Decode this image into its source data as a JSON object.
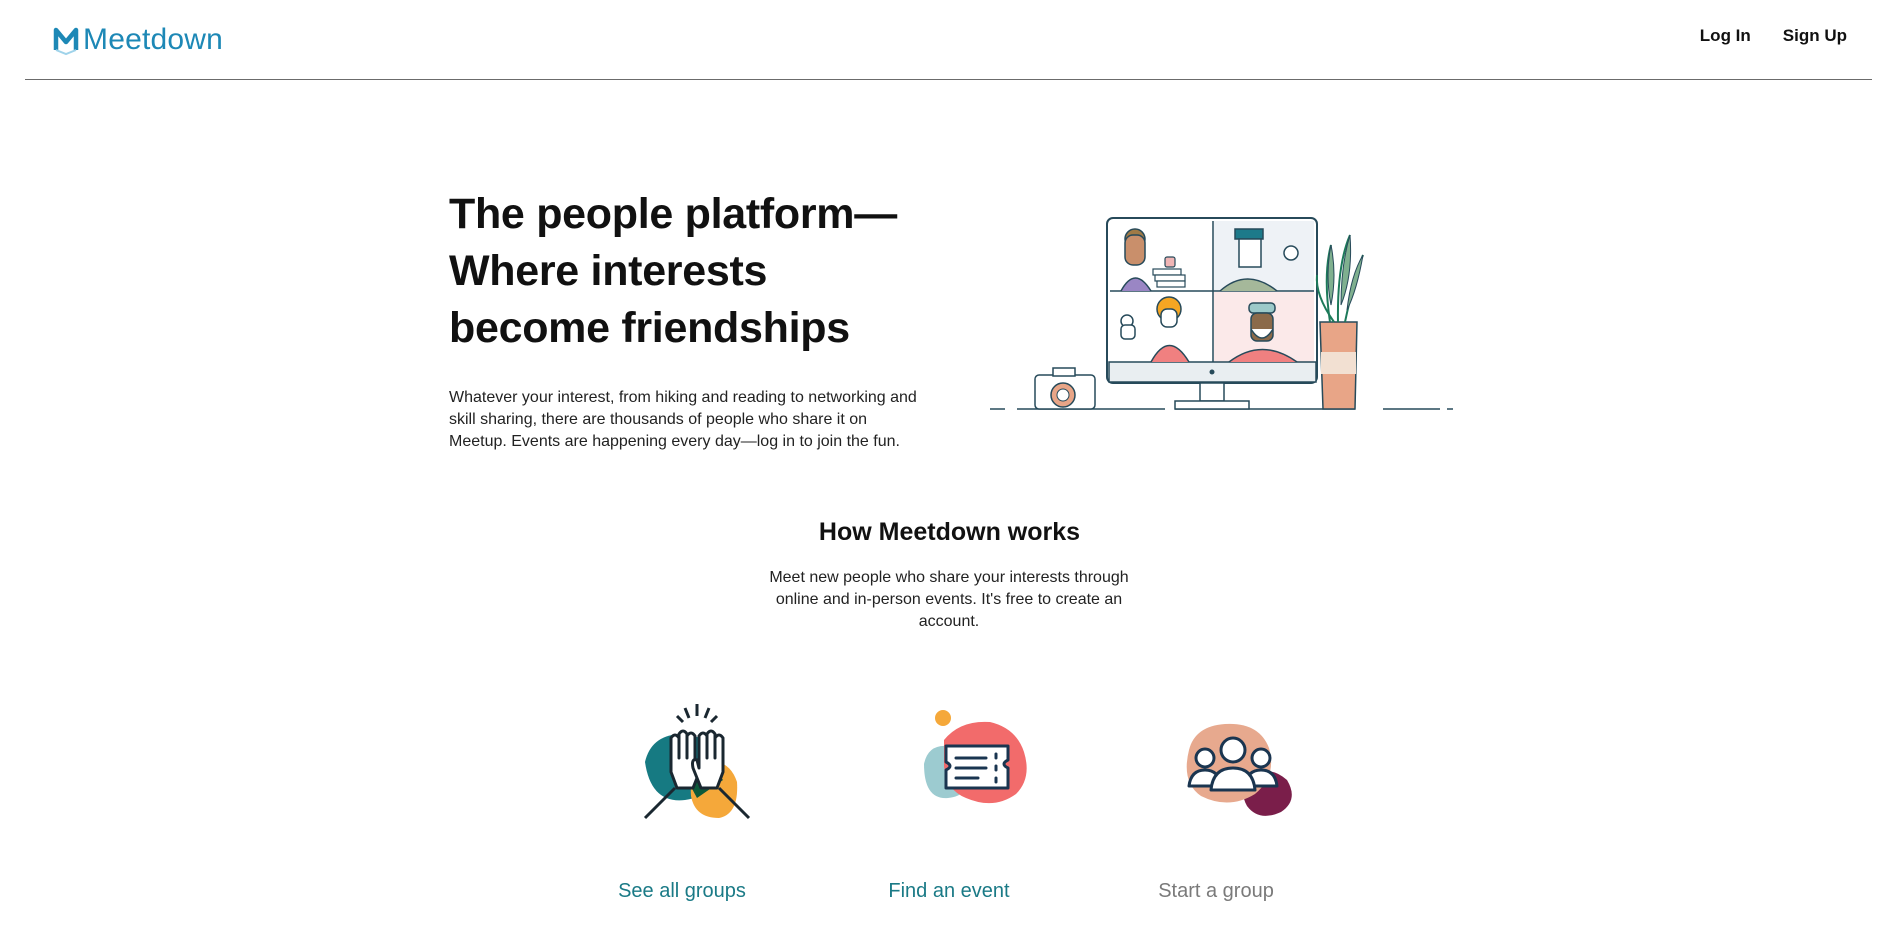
{
  "header": {
    "brand": "Meetdown",
    "nav": [
      {
        "label": "Log In"
      },
      {
        "label": "Sign Up"
      }
    ]
  },
  "hero": {
    "title_line1": "The people platform—",
    "title_line2": "Where interests",
    "title_line3": "become friendships",
    "description": "Whatever your interest, from hiking and reading to networking and skill sharing, there are thousands of people who share it on Meetup. Events are happening every day—log in to join the fun."
  },
  "how": {
    "title": "How Meetdown works",
    "description": "Meet new people who share your interests through online and in-person events. It's free to create an account."
  },
  "features": [
    {
      "label": "See all groups",
      "icon": "high-five-icon",
      "color": "#1a7a86"
    },
    {
      "label": "Find an event",
      "icon": "ticket-icon",
      "color": "#1a7a86"
    },
    {
      "label": "Start a group",
      "icon": "group-icon",
      "color": "#7a7a7a"
    }
  ],
  "colors": {
    "brand": "#1d88b6",
    "link": "#1a7a86",
    "muted_link": "#7a7a7a"
  }
}
